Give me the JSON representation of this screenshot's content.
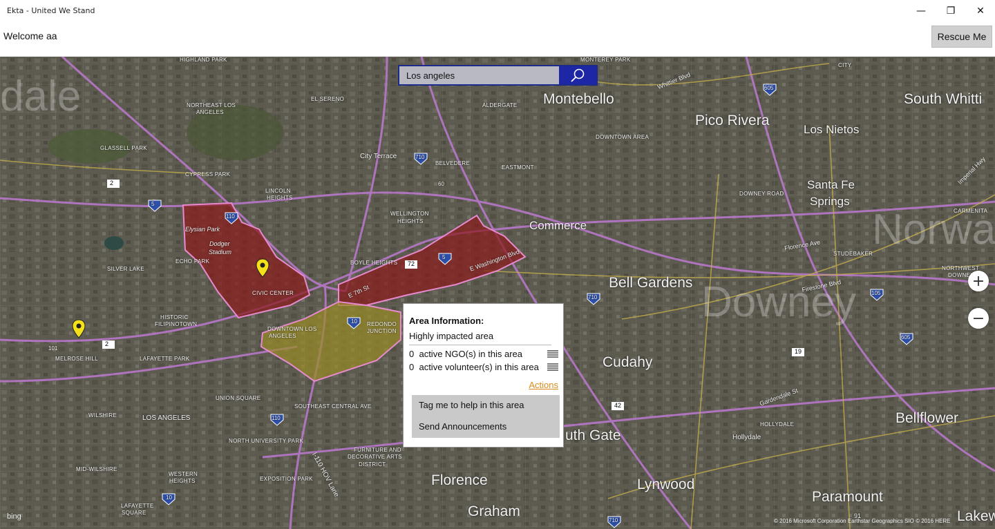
{
  "window": {
    "title": "Ekta - United We Stand",
    "controls": {
      "minimize": "—",
      "maximize": "❐",
      "close": "✕"
    }
  },
  "header": {
    "welcome": "Welcome  aa",
    "rescue_button": "Rescue Me"
  },
  "search": {
    "value": "Los angeles"
  },
  "map": {
    "cities_large": [
      "Montebello",
      "Pico Rivera",
      "Los Nietos",
      "South Whitti",
      "Santa Fe",
      "Springs",
      "Commerce",
      "Bell Gardens",
      "Cudahy",
      "Bellflower",
      "uth Gate",
      "Florence",
      "Lynwood",
      "Paramount",
      "Graham",
      "Lakew"
    ],
    "ghost_labels": [
      "dale",
      "Downey",
      "Norwa"
    ],
    "neighborhoods": [
      "HIGHLAND PARK",
      "NORTHEAST LOS",
      "ANGELES",
      "EL SERENO",
      "ALDERGATE",
      "MONTEREY PARK",
      "GLASSELL PARK",
      "CYPRESS PARK",
      "LINCOLN",
      "HEIGHTS",
      "Elysian Park",
      "Dodger",
      "Stadium",
      "ECHO PARK",
      "SILVER LAKE",
      "CIVIC CENTER",
      "BOYLE HEIGHTS",
      "WELLINGTON",
      "HEIGHTS",
      "HISTORIC",
      "FILIPINOTOWN",
      "DOWNTOWN LOS",
      "ANGELES",
      "REDONDO",
      "JUNCTION",
      "MELROSE HILL",
      "LAFAYETTE PARK",
      "WILSHIRE",
      "LOS ANGELES",
      "UNION SQUARE",
      "SOUTHEAST CENTRAL AVE",
      "NORTH UNIVERSITY PARK",
      "FURNITURE AND",
      "DECORATIVE ARTS",
      "DISTRICT",
      "EXPOSITION PARK",
      "WESTERN",
      "HEIGHTS",
      "MID-WILSHIRE",
      "LAFAYETTE",
      "SQUARE",
      "DOWNTOWN AREA",
      "EASTMONT",
      "BELVEDERE",
      "City Terrace",
      "DOWNEY ROAD",
      "STUDEBAKER",
      "NORTHWEST",
      "DOWNEY",
      "CARMENITA",
      "HOLLYDALE",
      "Hollydale",
      "CITY"
    ],
    "roads": [
      "I-110 HOV Lane",
      "E 7th St",
      "E Washington Blvd",
      "Firestone Blvd",
      "Imperial Hwy",
      "Gardendale St",
      "Florence Ave",
      "Whittier Blvd"
    ],
    "highway_shields": [
      "2",
      "5",
      "110",
      "101",
      "72",
      "5",
      "710",
      "60",
      "710",
      "605",
      "605",
      "19",
      "10",
      "110",
      "42",
      "710",
      "105",
      "91",
      "10",
      "2",
      "5"
    ],
    "attribution": "© 2016 Microsoft Corporation Earthstar Geographics SIO © 2016 HERE",
    "bing_logo": "bing"
  },
  "zoom": {
    "in": "+",
    "out": "−"
  },
  "popup": {
    "header": "Area Information:",
    "impact": "Highly impacted area",
    "ngo_count": "0",
    "ngo_label": "active NGO(s) in this area",
    "volunteer_count": "0",
    "volunteer_label": "active volunteer(s) in this area",
    "actions": "Actions",
    "menu": [
      "Tag me to help in this area",
      "Send Announcements"
    ]
  },
  "colors": {
    "search_border": "#1c2a8a",
    "search_button": "#1d27a6",
    "zone_high": "#8b1a1a",
    "zone_medium": "#9a8c25",
    "pin": "#f4e11a",
    "actions_link": "#d98c1a"
  }
}
